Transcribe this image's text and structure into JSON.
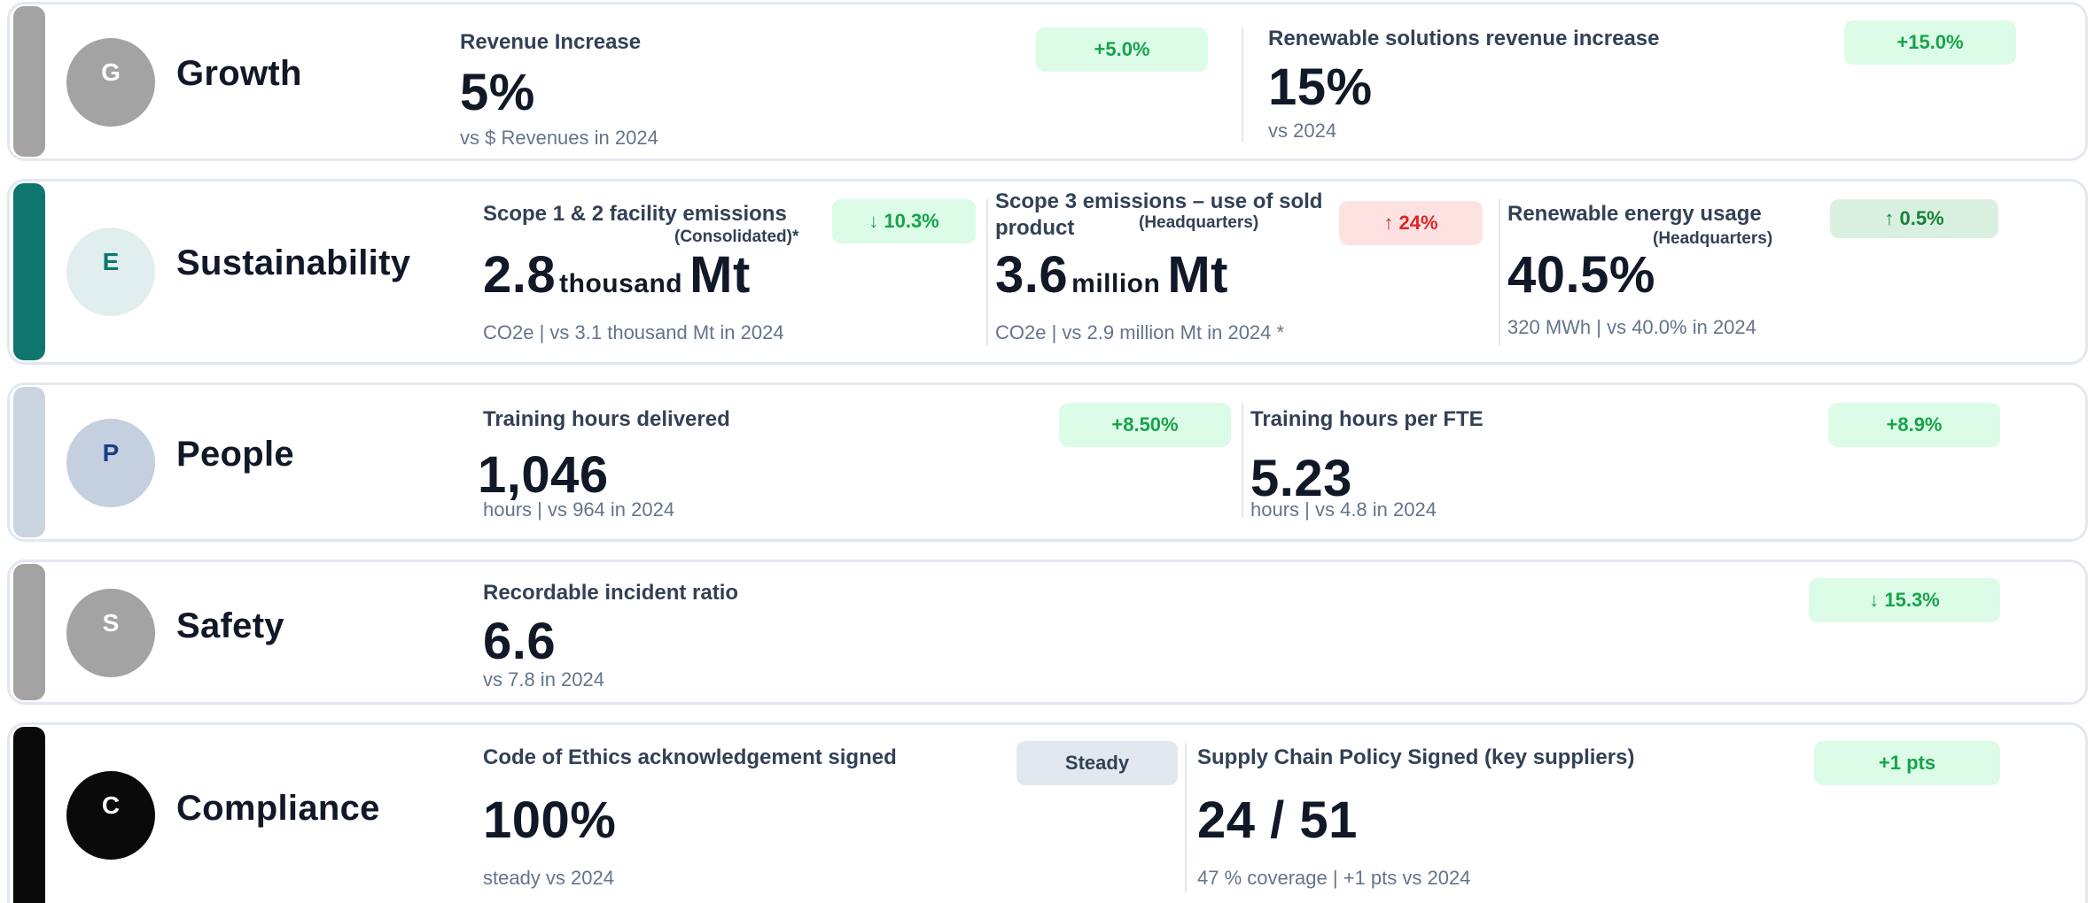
{
  "categories": {
    "growth": {
      "letter": "G",
      "title": "Growth",
      "bar_color": "#a3a3a3",
      "avatar_bg": "#a3a3a3",
      "avatar_fg": "#ffffff",
      "metrics": [
        {
          "label": "Revenue Increase",
          "value": "5%",
          "note": "vs $ Revenues  in 2024",
          "badge": "+5.0%"
        },
        {
          "label": "Renewable solutions revenue increase",
          "value": "15%",
          "note": "vs  2024",
          "badge": "+15.0%"
        }
      ]
    },
    "sustainability": {
      "letter": "E",
      "title": "Sustainability",
      "bar_color": "#0f766e",
      "avatar_bg": "#e0efee",
      "avatar_fg": "#0f766e",
      "metrics": [
        {
          "label": "Scope 1 & 2  facility emissions",
          "sublabel": "(Consolidated)*",
          "value_num": "2.8",
          "value_mid": "thousand",
          "value_unit": "Mt",
          "note": "CO2e | vs 3.1 thousand Mt in 2024",
          "badge": "↓ 10.3%"
        },
        {
          "label": "Scope 3 emissions – use of sold",
          "label_line2": "product",
          "sublabel": "(Headquarters)",
          "value_num": "3.6",
          "value_mid": "million",
          "value_unit": "Mt",
          "note": "CO2e | vs 2.9 million Mt in 2024 *",
          "badge": "↑ 24%"
        },
        {
          "label": "Renewable energy usage",
          "sublabel": "(Headquarters)",
          "value": "40.5%",
          "note": "320 MWh | vs 40.0% in 2024",
          "badge": "↑ 0.5%"
        }
      ]
    },
    "people": {
      "letter": "P",
      "title": "People",
      "bar_color": "#cbd5e1",
      "avatar_bg": "#c4d0e0",
      "avatar_fg": "#1e3a8a",
      "metrics": [
        {
          "label": "Training hours delivered",
          "value": "1,046",
          "note": "hours | vs 964 in 2024",
          "badge": "+8.50%"
        },
        {
          "label": "Training hours per FTE",
          "value": "5.23",
          "note": "hours | vs 4.8 in 2024",
          "badge": "+8.9%"
        }
      ]
    },
    "safety": {
      "letter": "S",
      "title": "Safety",
      "bar_color": "#a3a3a3",
      "avatar_bg": "#a3a3a3",
      "avatar_fg": "#ffffff",
      "metrics": [
        {
          "label": "Recordable incident ratio",
          "value": "6.6",
          "note": "vs 7.8 in 2024",
          "badge": "↓ 15.3%"
        }
      ]
    },
    "compliance": {
      "letter": "C",
      "title": "Compliance",
      "bar_color": "#0a0a0a",
      "avatar_bg": "#0a0a0a",
      "avatar_fg": "#ffffff",
      "metrics": [
        {
          "label": "Code of Ethics acknowledgement signed",
          "value": "100%",
          "note": "steady vs 2024",
          "badge": "Steady"
        },
        {
          "label": "Supply Chain Policy Signed (key suppliers)",
          "value": "24 / 51",
          "note": "47 % coverage | +1 pts vs 2024",
          "badge": "+1 pts"
        }
      ]
    }
  }
}
